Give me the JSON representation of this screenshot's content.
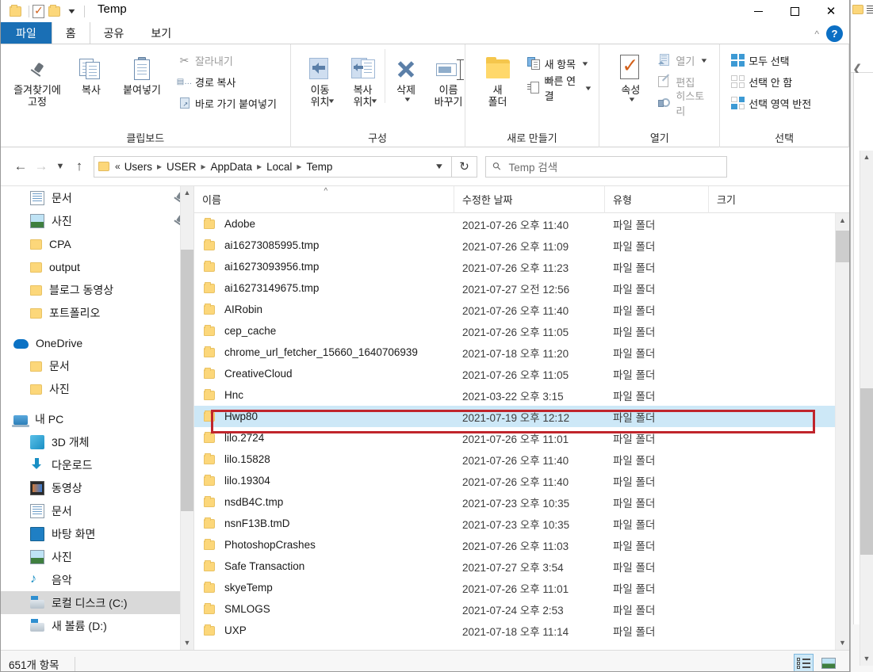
{
  "window": {
    "title": "Temp",
    "minimize_label": "최소화",
    "maximize_label": "최대화",
    "close_label": "닫기",
    "quick_access": {
      "folder_icon": "folder-icon",
      "properties_icon": "properties-icon",
      "dropdown_icon": "chevron-down-icon"
    }
  },
  "tabs": [
    {
      "label": "파일",
      "kind": "file"
    },
    {
      "label": "홈",
      "kind": "active"
    },
    {
      "label": "공유",
      "kind": "normal"
    },
    {
      "label": "보기",
      "kind": "normal"
    }
  ],
  "ribbon": {
    "collapse_icon": "chevron-up-icon",
    "help_icon": "help-icon",
    "groups": [
      {
        "title": "클립보드",
        "big": [
          {
            "label": "즐겨찾기에\n고정",
            "icon": "pin-icon"
          },
          {
            "label": "복사",
            "icon": "copy-icon"
          },
          {
            "label": "붙여넣기",
            "icon": "paste-icon"
          }
        ],
        "small": [
          {
            "label": "잘라내기",
            "icon": "scissors-icon"
          },
          {
            "label": "경로 복사",
            "icon": "copy-path-icon"
          },
          {
            "label": "바로 가기 붙여넣기",
            "icon": "paste-shortcut-icon"
          }
        ]
      },
      {
        "title": "구성",
        "big": [
          {
            "label": "이동\n위치",
            "icon": "move-to-icon",
            "caret": true
          },
          {
            "label": "복사\n위치",
            "icon": "copy-to-icon",
            "caret": true
          },
          {
            "label": "삭제",
            "icon": "delete-icon",
            "caret": true
          },
          {
            "label": "이름\n바꾸기",
            "icon": "rename-icon"
          }
        ],
        "small": []
      },
      {
        "title": "새로 만들기",
        "big": [
          {
            "label": "새\n폴더",
            "icon": "new-folder-icon"
          }
        ],
        "small": [
          {
            "label": "새 항목",
            "icon": "new-item-icon",
            "caret": true
          },
          {
            "label": "빠른 연결",
            "icon": "easy-access-icon",
            "caret": true
          }
        ]
      },
      {
        "title": "열기",
        "big": [
          {
            "label": "속성",
            "icon": "properties-icon",
            "caret": true
          }
        ],
        "small": [
          {
            "label": "열기",
            "icon": "open-icon",
            "caret": true,
            "dim": true
          },
          {
            "label": "편집",
            "icon": "edit-icon",
            "dim": true
          },
          {
            "label": "히스토리",
            "icon": "history-icon",
            "dim": true
          }
        ]
      },
      {
        "title": "선택",
        "big": [],
        "small": [
          {
            "label": "모두 선택",
            "icon": "select-all-icon"
          },
          {
            "label": "선택 안 함",
            "icon": "select-none-icon"
          },
          {
            "label": "선택 영역 반전",
            "icon": "invert-selection-icon"
          }
        ]
      }
    ]
  },
  "addressbar": {
    "back_icon": "arrow-left-icon",
    "forward_icon": "arrow-right-icon",
    "recent_icon": "chevron-down-icon",
    "up_icon": "arrow-up-icon",
    "folder_icon": "folder-icon",
    "overflow": "«",
    "crumbs": [
      "Users",
      "USER",
      "AppData",
      "Local",
      "Temp"
    ],
    "dropdown_icon": "chevron-down-icon",
    "refresh_icon": "refresh-icon",
    "search_icon": "search-icon",
    "search_placeholder": "Temp 검색",
    "search_value": ""
  },
  "navpane": {
    "items": [
      {
        "label": "문서",
        "icon": "documents-icon",
        "indent": 1,
        "pinned": true
      },
      {
        "label": "사진",
        "icon": "pictures-icon",
        "indent": 1,
        "pinned": true
      },
      {
        "label": "CPA",
        "icon": "folder-icon",
        "indent": 1
      },
      {
        "label": "output",
        "icon": "folder-icon",
        "indent": 1
      },
      {
        "label": "블로그 동영상",
        "icon": "folder-icon",
        "indent": 1
      },
      {
        "label": "포트폴리오",
        "icon": "folder-icon",
        "indent": 1
      },
      {
        "label": "OneDrive",
        "icon": "onedrive-icon",
        "indent": 0
      },
      {
        "label": "문서",
        "icon": "folder-icon",
        "indent": 1
      },
      {
        "label": "사진",
        "icon": "folder-icon",
        "indent": 1
      },
      {
        "label": "내 PC",
        "icon": "this-pc-icon",
        "indent": 0
      },
      {
        "label": "3D 개체",
        "icon": "3d-objects-icon",
        "indent": 1
      },
      {
        "label": "다운로드",
        "icon": "downloads-icon",
        "indent": 1
      },
      {
        "label": "동영상",
        "icon": "videos-icon",
        "indent": 1
      },
      {
        "label": "문서",
        "icon": "documents-icon",
        "indent": 1
      },
      {
        "label": "바탕 화면",
        "icon": "desktop-icon",
        "indent": 1
      },
      {
        "label": "사진",
        "icon": "pictures-icon",
        "indent": 1
      },
      {
        "label": "음악",
        "icon": "music-icon",
        "indent": 1
      },
      {
        "label": "로컬 디스크 (C:)",
        "icon": "disk-icon",
        "indent": 1,
        "selected": true
      },
      {
        "label": "새 볼륨 (D:)",
        "icon": "disk-icon",
        "indent": 1
      }
    ],
    "scroll_up_icon": "chevron-up-icon",
    "scroll_down_icon": "chevron-down-icon"
  },
  "filelist": {
    "columns": [
      {
        "label": "이름",
        "sorted": true,
        "sort_icon": "sort-asc-icon"
      },
      {
        "label": "수정한 날짜"
      },
      {
        "label": "유형"
      },
      {
        "label": "크기"
      }
    ],
    "rows": [
      {
        "name": "Adobe",
        "date": "2021-07-26 오후 11:40",
        "type": "파일 폴더",
        "size": ""
      },
      {
        "name": "ai16273085995.tmp",
        "date": "2021-07-26 오후 11:09",
        "type": "파일 폴더",
        "size": ""
      },
      {
        "name": "ai16273093956.tmp",
        "date": "2021-07-26 오후 11:23",
        "type": "파일 폴더",
        "size": ""
      },
      {
        "name": "ai16273149675.tmp",
        "date": "2021-07-27 오전 12:56",
        "type": "파일 폴더",
        "size": ""
      },
      {
        "name": "AIRobin",
        "date": "2021-07-26 오후 11:40",
        "type": "파일 폴더",
        "size": ""
      },
      {
        "name": "cep_cache",
        "date": "2021-07-26 오후 11:05",
        "type": "파일 폴더",
        "size": ""
      },
      {
        "name": "chrome_url_fetcher_15660_1640706939",
        "date": "2021-07-18 오후 11:20",
        "type": "파일 폴더",
        "size": ""
      },
      {
        "name": "CreativeCloud",
        "date": "2021-07-26 오후 11:05",
        "type": "파일 폴더",
        "size": ""
      },
      {
        "name": "Hnc",
        "date": "2021-03-22 오후 3:15",
        "type": "파일 폴더",
        "size": ""
      },
      {
        "name": "Hwp80",
        "date": "2021-07-19 오후 12:12",
        "type": "파일 폴더",
        "size": "",
        "selected": true
      },
      {
        "name": "lilo.2724",
        "date": "2021-07-26 오후 11:01",
        "type": "파일 폴더",
        "size": ""
      },
      {
        "name": "lilo.15828",
        "date": "2021-07-26 오후 11:40",
        "type": "파일 폴더",
        "size": ""
      },
      {
        "name": "lilo.19304",
        "date": "2021-07-26 오후 11:40",
        "type": "파일 폴더",
        "size": ""
      },
      {
        "name": "nsdB4C.tmp",
        "date": "2021-07-23 오후 10:35",
        "type": "파일 폴더",
        "size": ""
      },
      {
        "name": "nsnF13B.tmD",
        "date": "2021-07-23 오후 10:35",
        "type": "파일 폴더",
        "size": ""
      },
      {
        "name": "PhotoshopCrashes",
        "date": "2021-07-26 오후 11:03",
        "type": "파일 폴더",
        "size": ""
      },
      {
        "name": "Safe Transaction",
        "date": "2021-07-27 오후 3:54",
        "type": "파일 폴더",
        "size": ""
      },
      {
        "name": "skyeTemp",
        "date": "2021-07-26 오후 11:01",
        "type": "파일 폴더",
        "size": ""
      },
      {
        "name": "SMLOGS",
        "date": "2021-07-24 오후 2:53",
        "type": "파일 폴더",
        "size": ""
      },
      {
        "name": "UXP",
        "date": "2021-07-18 오후 11:14",
        "type": "파일 폴더",
        "size": ""
      }
    ],
    "scroll_up_icon": "chevron-up-icon",
    "scroll_down_icon": "chevron-down-icon"
  },
  "annotation": {
    "color": "#c0252c",
    "target": "Hwp80"
  },
  "statusbar": {
    "item_count": "651개 항목",
    "details_view_icon": "details-view-icon",
    "thumbnail_view_icon": "large-icons-view-icon"
  }
}
